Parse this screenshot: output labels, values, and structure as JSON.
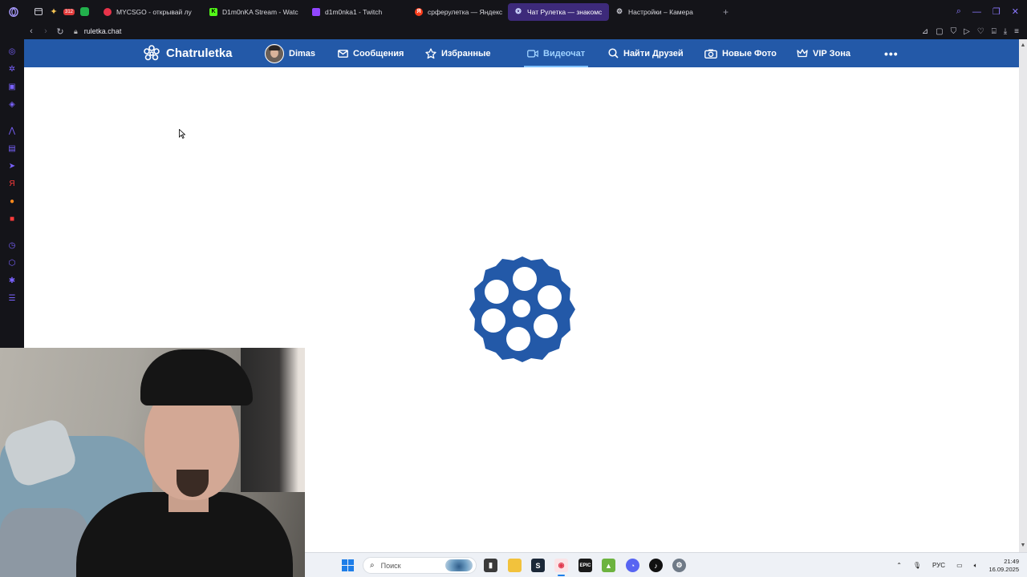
{
  "browser": {
    "tabs": [
      {
        "title": "MYCSGO - открывай лу",
        "favicon": "mycsgo-icon",
        "color": "#e8334a"
      },
      {
        "title": "D1m0nKA Stream - Watc",
        "favicon": "kick-icon",
        "color": "#53fc18"
      },
      {
        "title": "d1m0nka1 - Twitch",
        "favicon": "twitch-icon",
        "color": "#9146ff"
      },
      {
        "title": "срферулетка — Яндекс",
        "favicon": "yandex-icon",
        "color": "#fc3f1d"
      },
      {
        "title": "Чат Рулетка — знакомс",
        "favicon": "chatruletka-icon",
        "color": "#2359a8",
        "active": true
      },
      {
        "title": "Настройки – Камера",
        "favicon": "settings-icon",
        "color": "#9a9aa6"
      }
    ],
    "badge_count": "312",
    "url": "ruletka.chat"
  },
  "site": {
    "brand": "Chatruletka",
    "nav": {
      "profile": "Dimas",
      "messages": "Сообщения",
      "favorites": "Избранные",
      "videochat": "Видеочат",
      "find_friends": "Найти Друзей",
      "new_photos": "Новые Фото",
      "vip": "VIP Зона",
      "more": "•••"
    },
    "accent_color": "#2359a8"
  },
  "taskbar": {
    "search_placeholder": "Поиск",
    "language": "РУС",
    "time": "21:49",
    "date": "16.09.2025"
  }
}
